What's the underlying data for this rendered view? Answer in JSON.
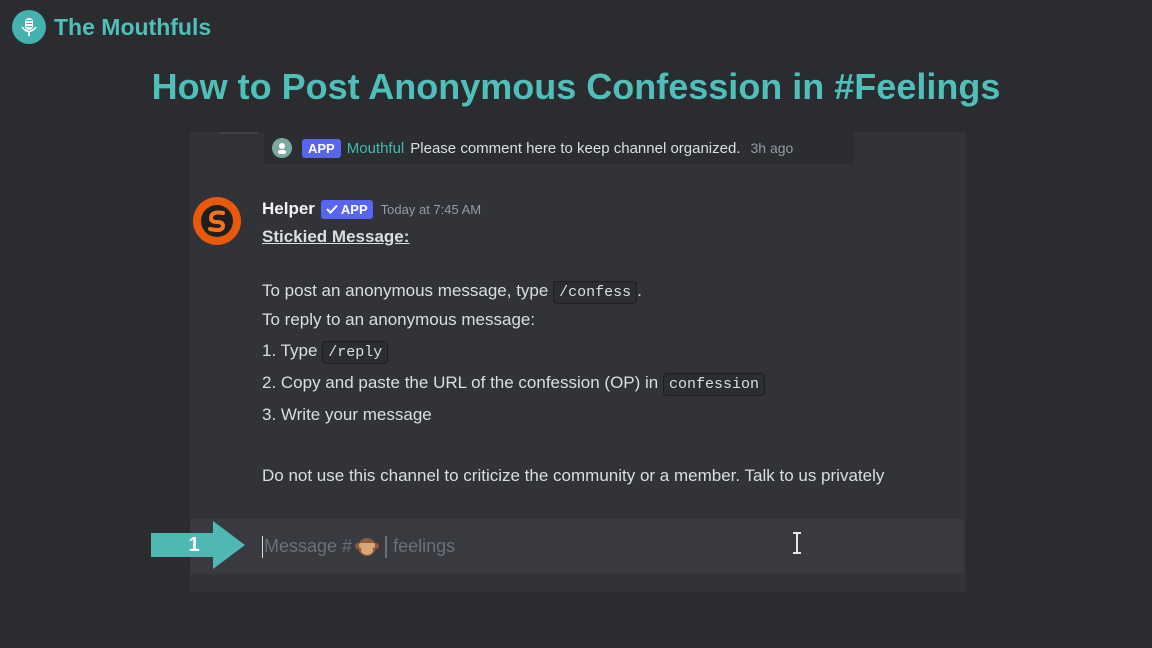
{
  "brand": {
    "name": "The Mouthfuls"
  },
  "page_title": "How to Post Anonymous Confession in #Feelings",
  "pinned": {
    "tag": "APP",
    "author": "Mouthful",
    "text": "Please comment here to keep channel organized.",
    "time": "3h ago"
  },
  "message": {
    "author": "Helper",
    "badge": "APP",
    "timestamp": "Today at 7:45 AM",
    "sticky_title": "Stickied Message:",
    "line1_before": "To post an anonymous message, type",
    "line1_code": "/confess",
    "line1_after": ".",
    "line2": "To reply to an anonymous message:",
    "step1_text": "1. Type",
    "step1_code": "/reply",
    "step2_text": "2. Copy and paste the URL of the confession (OP) in",
    "step2_code": "confession",
    "step3_text": "3. Write your message",
    "footer": "Do not use this channel to criticize the community or a member. Talk to us privately"
  },
  "composer": {
    "placeholder_prefix": "Message #",
    "channel": "feelings"
  },
  "step_marker": {
    "label": "1"
  },
  "colors": {
    "accent": "#4fbfb9",
    "app_badge": "#5865f2",
    "step_arrow": "#4fb8b2"
  }
}
